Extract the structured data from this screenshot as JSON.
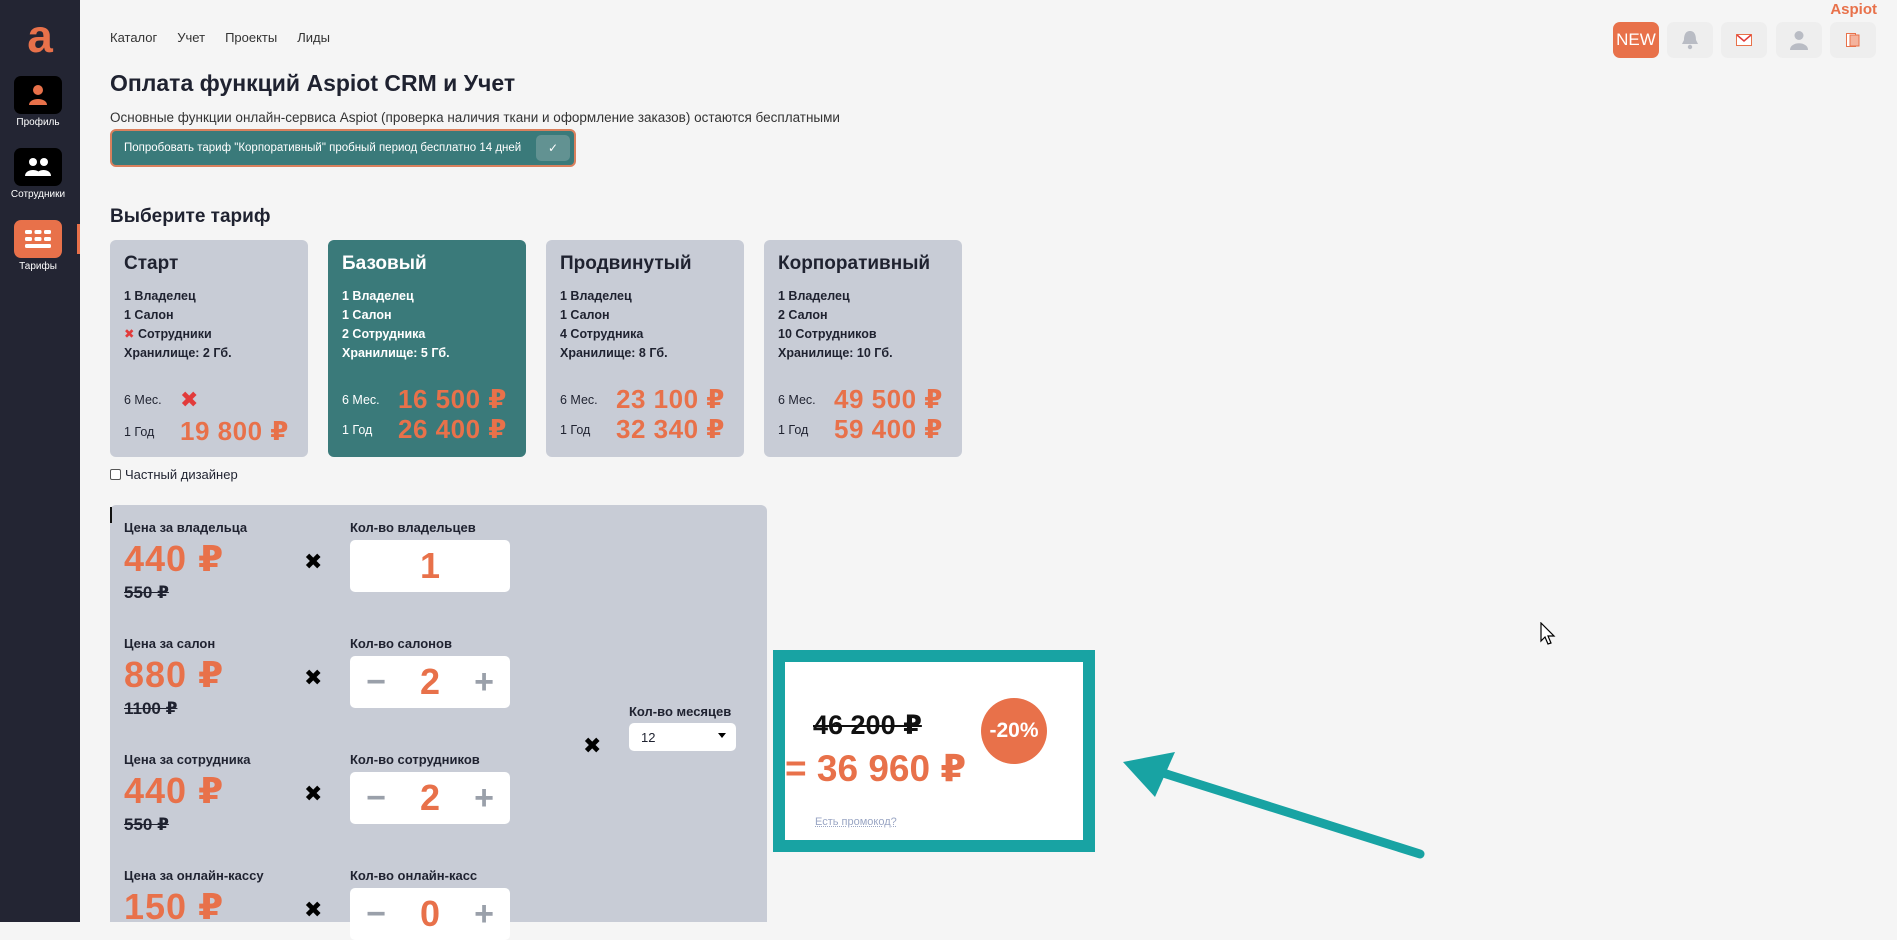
{
  "brand": "Aspiot",
  "colors": {
    "accent": "#e8714a",
    "teal": "#3a7a7a",
    "highlight": "#18a3a3",
    "sidebar": "#232533"
  },
  "sidebar": {
    "items": [
      {
        "label": "Профиль",
        "icon": "user-icon"
      },
      {
        "label": "Сотрудники",
        "icon": "users-icon"
      },
      {
        "label": "Тарифы",
        "icon": "grid-icon",
        "active": true
      }
    ]
  },
  "topnav": {
    "items": [
      "Каталог",
      "Учет",
      "Проекты",
      "Лиды"
    ]
  },
  "top_buttons": {
    "new_label": "NEW"
  },
  "page": {
    "title": "Оплата функций Aspiot CRM и Учет",
    "subtitle": "Основные функции онлайн-сервиса Aspiot (проверка наличия ткани и оформление заказов) остаются бесплатными",
    "trial_button": "Попробовать тариф \"Корпоративный\" пробный период бесплатно 14 дней",
    "choose_title": "Выберите тариф"
  },
  "tariffs": [
    {
      "name": "Старт",
      "features": [
        "1 Владелец",
        "1 Салон",
        "Сотрудники",
        "Хранилище: 2 Гб."
      ],
      "employees_unavailable": true,
      "m6_label": "6 Мес.",
      "m6_price": "✖",
      "y1_label": "1 Год",
      "y1_price": "19 800 ₽"
    },
    {
      "name": "Базовый",
      "features": [
        "1 Владелец",
        "1 Салон",
        "2 Сотрудника",
        "Хранилище: 5 Гб."
      ],
      "selected": true,
      "m6_label": "6 Мес.",
      "m6_price": "16 500 ₽",
      "y1_label": "1 Год",
      "y1_price": "26 400 ₽"
    },
    {
      "name": "Продвинутый",
      "features": [
        "1 Владелец",
        "1 Салон",
        "4 Сотрудника",
        "Хранилище: 8 Гб."
      ],
      "m6_label": "6 Мес.",
      "m6_price": "23 100 ₽",
      "y1_label": "1 Год",
      "y1_price": "32 340 ₽"
    },
    {
      "name": "Корпоративный",
      "features": [
        "1 Владелец",
        "2 Салон",
        "10 Сотрудников",
        "Хранилище: 10 Гб."
      ],
      "m6_label": "6 Мес.",
      "m6_price": "49 500 ₽",
      "y1_label": "1 Год",
      "y1_price": "59 400 ₽"
    }
  ],
  "private_designer": "Частный дизайнер",
  "calc": {
    "rows": [
      {
        "price_label": "Цена за владельца",
        "price": "440 ₽",
        "old_price": "550 ₽",
        "qty_label": "Кол-во владельцев",
        "qty": "1"
      },
      {
        "price_label": "Цена за салон",
        "price": "880 ₽",
        "old_price": "1100 ₽",
        "qty_label": "Кол-во салонов",
        "qty": "2"
      },
      {
        "price_label": "Цена за сотрудника",
        "price": "440 ₽",
        "old_price": "550 ₽",
        "qty_label": "Кол-во сотрудников",
        "qty": "2"
      },
      {
        "price_label": "Цена за онлайн-кассу",
        "price": "150 ₽",
        "qty_label": "Кол-во онлайн-касс",
        "qty": "0"
      }
    ],
    "times": "✖",
    "months_label": "Кол-во месяцев",
    "months_value": "12"
  },
  "result": {
    "old_total": "46 200 ₽",
    "new_total": "= 36 960 ₽",
    "discount": "-20%",
    "promo": "Есть промокод?"
  }
}
